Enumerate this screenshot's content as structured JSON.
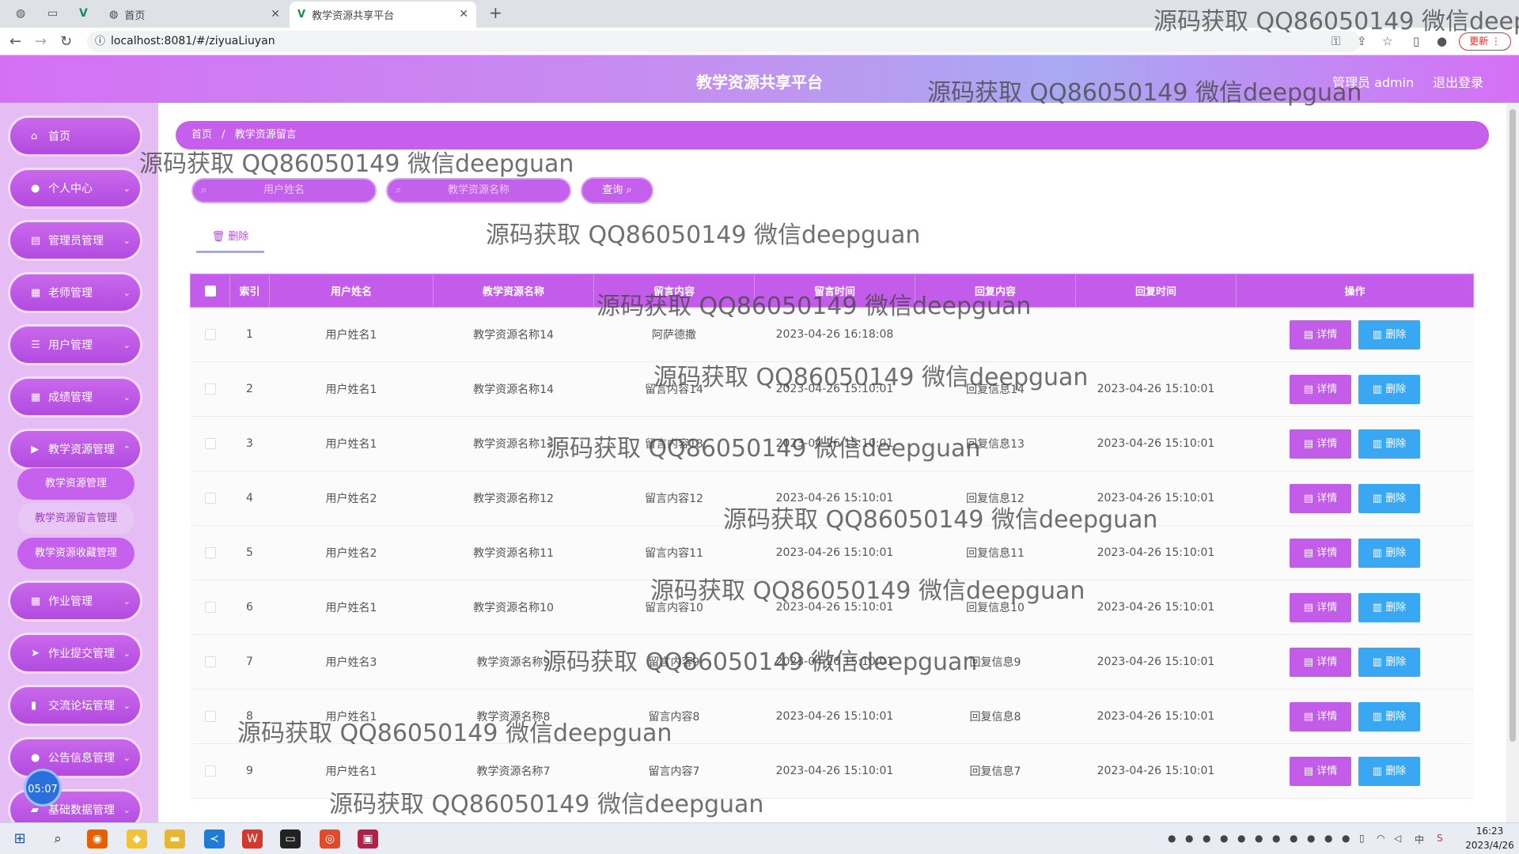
{
  "browser": {
    "tabs": [
      {
        "title": ""
      },
      {
        "title": ""
      },
      {
        "title": ""
      },
      {
        "title": "首页"
      },
      {
        "title": "教学资源共享平台"
      }
    ],
    "url": "localhost:8081/#/ziyuaLiuyan",
    "update_label": "更新"
  },
  "header": {
    "title": "教学资源共享平台",
    "admin_label": "管理员 admin",
    "logout_label": "退出登录"
  },
  "sidebar": {
    "items": [
      {
        "label": "首页",
        "icon": "home-icon"
      },
      {
        "label": "个人中心",
        "icon": "user-icon"
      },
      {
        "label": "管理员管理",
        "icon": "clipboard-icon"
      },
      {
        "label": "老师管理",
        "icon": "grid-icon"
      },
      {
        "label": "用户管理",
        "icon": "list-icon"
      },
      {
        "label": "成绩管理",
        "icon": "grid-icon"
      },
      {
        "label": "教学资源管理",
        "icon": "video-icon"
      },
      {
        "label": "作业管理",
        "icon": "grid-icon"
      },
      {
        "label": "作业提交管理",
        "icon": "send-icon"
      },
      {
        "label": "交流论坛管理",
        "icon": "bar-chart-icon"
      },
      {
        "label": "公告信息管理",
        "icon": "pin-icon"
      },
      {
        "label": "基础数据管理",
        "icon": "folder-icon"
      }
    ],
    "subitems": [
      {
        "label": "教学资源管理"
      },
      {
        "label": "教学资源留言管理"
      },
      {
        "label": "教学资源收藏管理"
      }
    ],
    "clock": "05:07"
  },
  "breadcrumb": {
    "home": "首页",
    "separator": "/",
    "current": "教学资源留言"
  },
  "search": {
    "user_placeholder": "用户姓名",
    "resource_placeholder": "教学资源名称",
    "query_label": "查询"
  },
  "actions": {
    "bulk_delete_label": "删除",
    "detail_label": "详情",
    "delete_label": "删除"
  },
  "table": {
    "headers": [
      "索引",
      "用户姓名",
      "教学资源名称",
      "留言内容",
      "留言时间",
      "回复内容",
      "回复时间",
      "操作"
    ],
    "rows": [
      [
        "1",
        "用户姓名1",
        "教学资源名称14",
        "阿萨德撒",
        "2023-04-26 16:18:08",
        "",
        ""
      ],
      [
        "2",
        "用户姓名1",
        "教学资源名称14",
        "留言内容14",
        "2023-04-26 15:10:01",
        "回复信息14",
        "2023-04-26 15:10:01"
      ],
      [
        "3",
        "用户姓名1",
        "教学资源名称13",
        "留言内容13",
        "2023-04-26 15:10:01",
        "回复信息13",
        "2023-04-26 15:10:01"
      ],
      [
        "4",
        "用户姓名2",
        "教学资源名称12",
        "留言内容12",
        "2023-04-26 15:10:01",
        "回复信息12",
        "2023-04-26 15:10:01"
      ],
      [
        "5",
        "用户姓名2",
        "教学资源名称11",
        "留言内容11",
        "2023-04-26 15:10:01",
        "回复信息11",
        "2023-04-26 15:10:01"
      ],
      [
        "6",
        "用户姓名1",
        "教学资源名称10",
        "留言内容10",
        "2023-04-26 15:10:01",
        "回复信息10",
        "2023-04-26 15:10:01"
      ],
      [
        "7",
        "用户姓名3",
        "教学资源名称9",
        "留言内容9",
        "2023-04-26 15:10:01",
        "回复信息9",
        "2023-04-26 15:10:01"
      ],
      [
        "8",
        "用户姓名1",
        "教学资源名称8",
        "留言内容8",
        "2023-04-26 15:10:01",
        "回复信息8",
        "2023-04-26 15:10:01"
      ],
      [
        "9",
        "用户姓名1",
        "教学资源名称7",
        "留言内容7",
        "2023-04-26 15:10:01",
        "回复信息7",
        "2023-04-26 15:10:01"
      ]
    ]
  },
  "watermark": "源码获取 QQ86050149 微信deepguan",
  "watermark_partial": "源码获取 QQ86050149 微信deep",
  "taskbar": {
    "time": "16:23",
    "date": "2023/4/26",
    "ime": "中"
  },
  "colors": {
    "primary": "#c35cea",
    "delete_button": "#3aa7f3",
    "sidebar_bg": "#e6bcf5"
  }
}
